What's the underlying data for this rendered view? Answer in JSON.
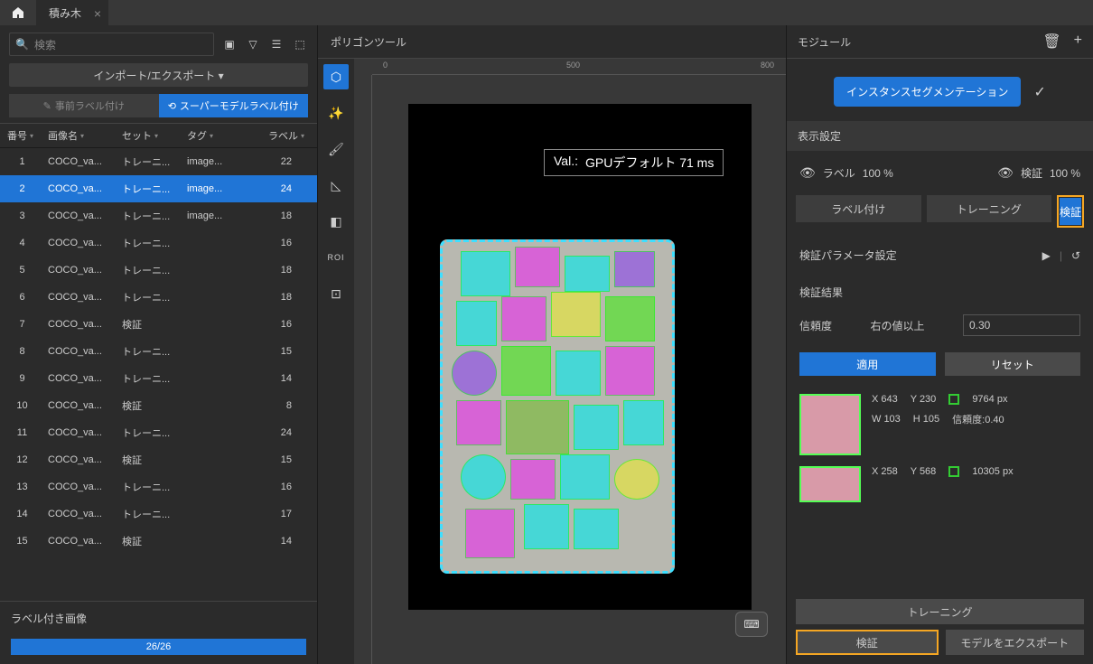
{
  "titlebar": {
    "tab_name": "積み木"
  },
  "search": {
    "placeholder": "検索"
  },
  "import_export": "インポート/エクスポート ▾",
  "prelabel": "事前ラベル付け",
  "superlabel": "スーパーモデルラベル付け",
  "columns": {
    "c1": "番号",
    "c2": "画像名",
    "c3": "セット",
    "c4": "タグ",
    "c5": "ラベル"
  },
  "rows": [
    {
      "n": "1",
      "img": "COCO_va...",
      "set": "トレーニ...",
      "tag": "image...",
      "lbl": "22"
    },
    {
      "n": "2",
      "img": "COCO_va...",
      "set": "トレーニ...",
      "tag": "image...",
      "lbl": "24"
    },
    {
      "n": "3",
      "img": "COCO_va...",
      "set": "トレーニ...",
      "tag": "image...",
      "lbl": "18"
    },
    {
      "n": "4",
      "img": "COCO_va...",
      "set": "トレーニ...",
      "tag": "",
      "lbl": "16"
    },
    {
      "n": "5",
      "img": "COCO_va...",
      "set": "トレーニ...",
      "tag": "",
      "lbl": "18"
    },
    {
      "n": "6",
      "img": "COCO_va...",
      "set": "トレーニ...",
      "tag": "",
      "lbl": "18"
    },
    {
      "n": "7",
      "img": "COCO_va...",
      "set": "検証",
      "tag": "",
      "lbl": "16"
    },
    {
      "n": "8",
      "img": "COCO_va...",
      "set": "トレーニ...",
      "tag": "",
      "lbl": "15"
    },
    {
      "n": "9",
      "img": "COCO_va...",
      "set": "トレーニ...",
      "tag": "",
      "lbl": "14"
    },
    {
      "n": "10",
      "img": "COCO_va...",
      "set": "検証",
      "tag": "",
      "lbl": "8"
    },
    {
      "n": "11",
      "img": "COCO_va...",
      "set": "トレーニ...",
      "tag": "",
      "lbl": "24"
    },
    {
      "n": "12",
      "img": "COCO_va...",
      "set": "検証",
      "tag": "",
      "lbl": "15"
    },
    {
      "n": "13",
      "img": "COCO_va...",
      "set": "トレーニ...",
      "tag": "",
      "lbl": "16"
    },
    {
      "n": "14",
      "img": "COCO_va...",
      "set": "トレーニ...",
      "tag": "",
      "lbl": "17"
    },
    {
      "n": "15",
      "img": "COCO_va...",
      "set": "検証",
      "tag": "",
      "lbl": "14"
    }
  ],
  "labeled_images": "ラベル付き画像",
  "progress": "26/26",
  "center_title": "ポリゴンツール",
  "ruler": {
    "t0": "0",
    "t500": "500",
    "t800": "800"
  },
  "tool_roi": "ROI",
  "val_prefix": "Val.:",
  "val_text": "GPUデフォルト 71 ms",
  "right": {
    "title": "モジュール",
    "chip": "インスタンスセグメンテーション",
    "display_settings": "表示設定",
    "label": "ラベル",
    "label_pct": "100 %",
    "verify": "検証",
    "verify_pct": "100 %",
    "tabs": {
      "t1": "ラベル付け",
      "t2": "トレーニング",
      "t3": "検証"
    },
    "params": "検証パラメータ設定",
    "results": "検証結果",
    "confidence": "信頼度",
    "gte": "右の値以上",
    "conf_value": "0.30",
    "apply": "適用",
    "reset": "リセット",
    "r1": {
      "x": "X 643",
      "y": "Y 230",
      "px": "9764 px",
      "w": "W 103",
      "h": "H 105",
      "conf": "信頼度:0.40"
    },
    "r2": {
      "x": "X 258",
      "y": "Y 568",
      "px": "10305 px"
    },
    "training_btn": "トレーニング",
    "verify_btn": "検証",
    "export_btn": "モデルをエクスポート"
  }
}
